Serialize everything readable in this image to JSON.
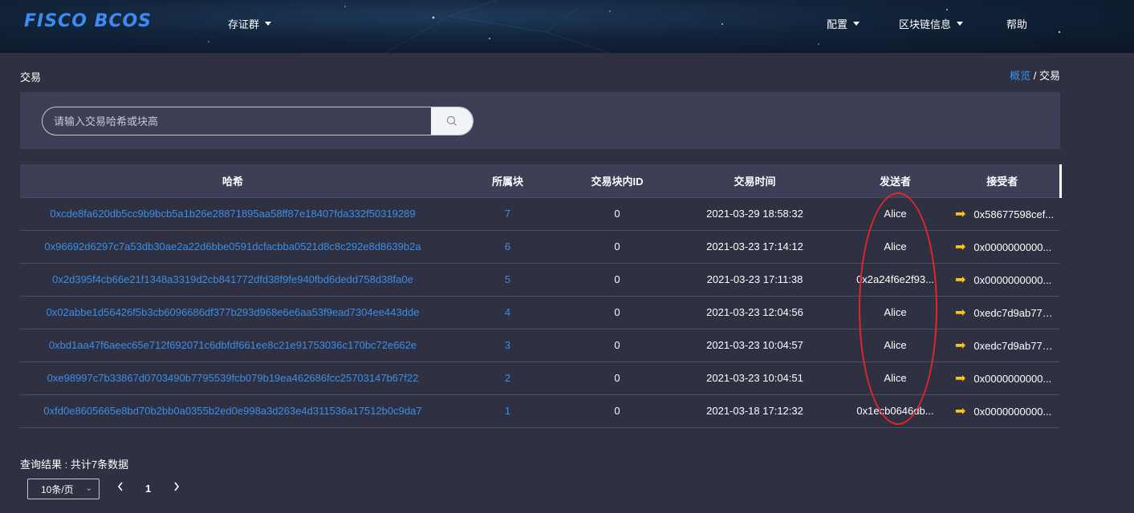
{
  "header": {
    "logo": "FISCO BCOS",
    "nav_left": [
      {
        "label": "存证群",
        "has_caret": true
      }
    ],
    "nav_right": [
      {
        "label": "配置",
        "has_caret": true
      },
      {
        "label": "区块链信息",
        "has_caret": true
      },
      {
        "label": "帮助",
        "has_caret": false
      }
    ]
  },
  "page": {
    "title": "交易",
    "breadcrumb": {
      "link": "概览",
      "separator": " / ",
      "current": "交易"
    }
  },
  "search": {
    "placeholder": "请输入交易哈希或块高",
    "value": ""
  },
  "table": {
    "headers": [
      "哈希",
      "所属块",
      "交易块内ID",
      "交易时间",
      "发送者",
      "接受者"
    ],
    "rows": [
      {
        "hash": "0xcde8fa620db5cc9b9bcb5a1b26e28871895aa58ff87e18407fda332f50319289",
        "block": "7",
        "index": "0",
        "time": "2021-03-29 18:58:32",
        "sender": "Alice",
        "receiver": "0x58677598cef..."
      },
      {
        "hash": "0x96692d6297c7a53db30ae2a22d6bbe0591dcfacbba0521d8c8c292e8d8639b2a",
        "block": "6",
        "index": "0",
        "time": "2021-03-23 17:14:12",
        "sender": "Alice",
        "receiver": "0x0000000000..."
      },
      {
        "hash": "0x2d395f4cb66e21f1348a3319d2cb841772dfd38f9fe940fbd6dedd758d38fa0e",
        "block": "5",
        "index": "0",
        "time": "2021-03-23 17:11:38",
        "sender": "0x2a24f6e2f93...",
        "receiver": "0x0000000000..."
      },
      {
        "hash": "0x02abbe1d56426f5b3cb6096686df377b293d968e6e6aa53f9ead7304ee443dde",
        "block": "4",
        "index": "0",
        "time": "2021-03-23 12:04:56",
        "sender": "Alice",
        "receiver": "0xedc7d9ab770..."
      },
      {
        "hash": "0xbd1aa47f6aeec65e712f692071c6dbfdf661ee8c21e91753036c170bc72e662e",
        "block": "3",
        "index": "0",
        "time": "2021-03-23 10:04:57",
        "sender": "Alice",
        "receiver": "0xedc7d9ab770..."
      },
      {
        "hash": "0xe98997c7b33867d0703490b7795539fcb079b19ea462686fcc25703147b67f22",
        "block": "2",
        "index": "0",
        "time": "2021-03-23 10:04:51",
        "sender": "Alice",
        "receiver": "0x0000000000..."
      },
      {
        "hash": "0xfd0e8605665e8bd70b2bb0a0355b2ed0e998a3d263e4d311536a17512b0c9da7",
        "block": "1",
        "index": "0",
        "time": "2021-03-18 17:12:32",
        "sender": "0x1ecb0646db...",
        "receiver": "0x0000000000..."
      }
    ]
  },
  "footer": {
    "result_text": "查询结果 : 共计7条数据",
    "page_size": "10条/页",
    "current_page": "1"
  },
  "colors": {
    "link": "#3a8ee6",
    "arrow": "#f5c518",
    "annotation": "#e3262b",
    "background": "#2f3142",
    "panel": "#3c3f56"
  },
  "icons": {
    "search": "search-icon",
    "arrow": "right-arrow-icon",
    "prev": "chevron-left-icon",
    "next": "chevron-right-icon"
  }
}
